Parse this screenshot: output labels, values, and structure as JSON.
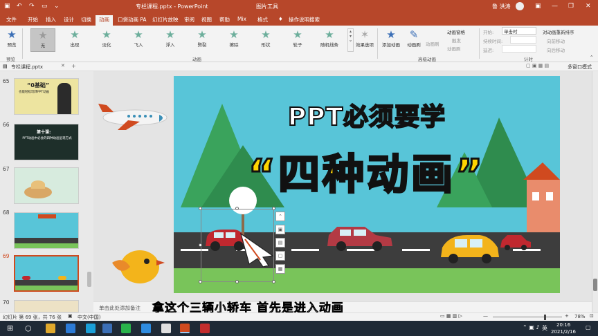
{
  "titlebar": {
    "title": "专栏课程.pptx  -  PowerPoint",
    "tool": "图片工具",
    "user": "鲁 洪涛"
  },
  "tabs": [
    "文件",
    "开始",
    "插入",
    "设计",
    "切换",
    "动画",
    "口袋动画 PA",
    "幻灯片放映",
    "审阅",
    "视图",
    "帮助",
    "Mix",
    "格式"
  ],
  "tell_me": "操作说明搜索",
  "ribbon": {
    "preview": "预览",
    "preview_group": "预览",
    "animations": [
      "无",
      "出现",
      "淡化",
      "飞入",
      "浮入",
      "劈裂",
      "擦除",
      "形状",
      "轮子",
      "随机线条"
    ],
    "effect_options": "效果选项",
    "anim_group": "动画",
    "add_anim": "添加动画",
    "painter": "动画刷",
    "anim_pane": "动画窗格",
    "trigger": "触发",
    "copy_anim": "动画刷",
    "adv_group": "高级动画",
    "start_label": "开始:",
    "start_value": "单击时",
    "duration_label": "持续时间:",
    "delay_label": "延迟:",
    "reorder": "对动画重新排序",
    "move_earlier": "向前移动",
    "move_later": "向后移动",
    "timing_group": "计时"
  },
  "fileline": {
    "tab": "专栏课程.pptx",
    "right": "多窗口模式"
  },
  "thumbs": [
    {
      "num": "65",
      "title": "“0基础”",
      "sub": "也能轻松玩转PPT动画"
    },
    {
      "num": "66",
      "title": "第十课:",
      "sub": "PPT动画中必会的四种动画呈现方式"
    },
    {
      "num": "67"
    },
    {
      "num": "68"
    },
    {
      "num": "69"
    },
    {
      "num": "70"
    }
  ],
  "slide": {
    "title": "PPT必须要学",
    "quote_open": "“",
    "main": "四种动画",
    "quote_close": "”"
  },
  "notes": "单击此处添加备注",
  "status": {
    "slide_info": "幻灯片 第 69 张，共 76 张",
    "lang": "中文(中国)",
    "zoom": "78%"
  },
  "subtitle": "拿这个三辆小轿车  首先是进入动画",
  "taskbar": {
    "time": "20:16",
    "date": "2021/2/16",
    "ime": "英"
  }
}
